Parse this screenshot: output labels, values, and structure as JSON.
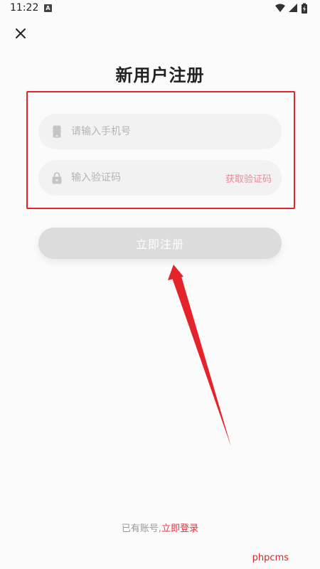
{
  "status_bar": {
    "time": "11:22",
    "notification_icon_letter": "A",
    "icons": [
      "wifi-icon",
      "signal-icon",
      "battery-charging-icon"
    ]
  },
  "header": {
    "close_icon": "close-icon",
    "title": "新用户注册"
  },
  "form": {
    "phone": {
      "icon": "phone-icon",
      "placeholder": "请输入手机号",
      "value": ""
    },
    "code": {
      "icon": "lock-icon",
      "placeholder": "输入验证码",
      "value": "",
      "get_code_label": "获取验证码"
    },
    "submit_label": "立即注册"
  },
  "footer": {
    "has_account_text": "已有账号,",
    "login_link": "立即登录"
  },
  "watermark": "phpcms",
  "colors": {
    "accent": "#e5323e",
    "get_code": "#e88a96",
    "highlight_frame": "#e5232a",
    "button_disabled": "#dcdcdc",
    "field_bg": "#f2f2f2"
  }
}
